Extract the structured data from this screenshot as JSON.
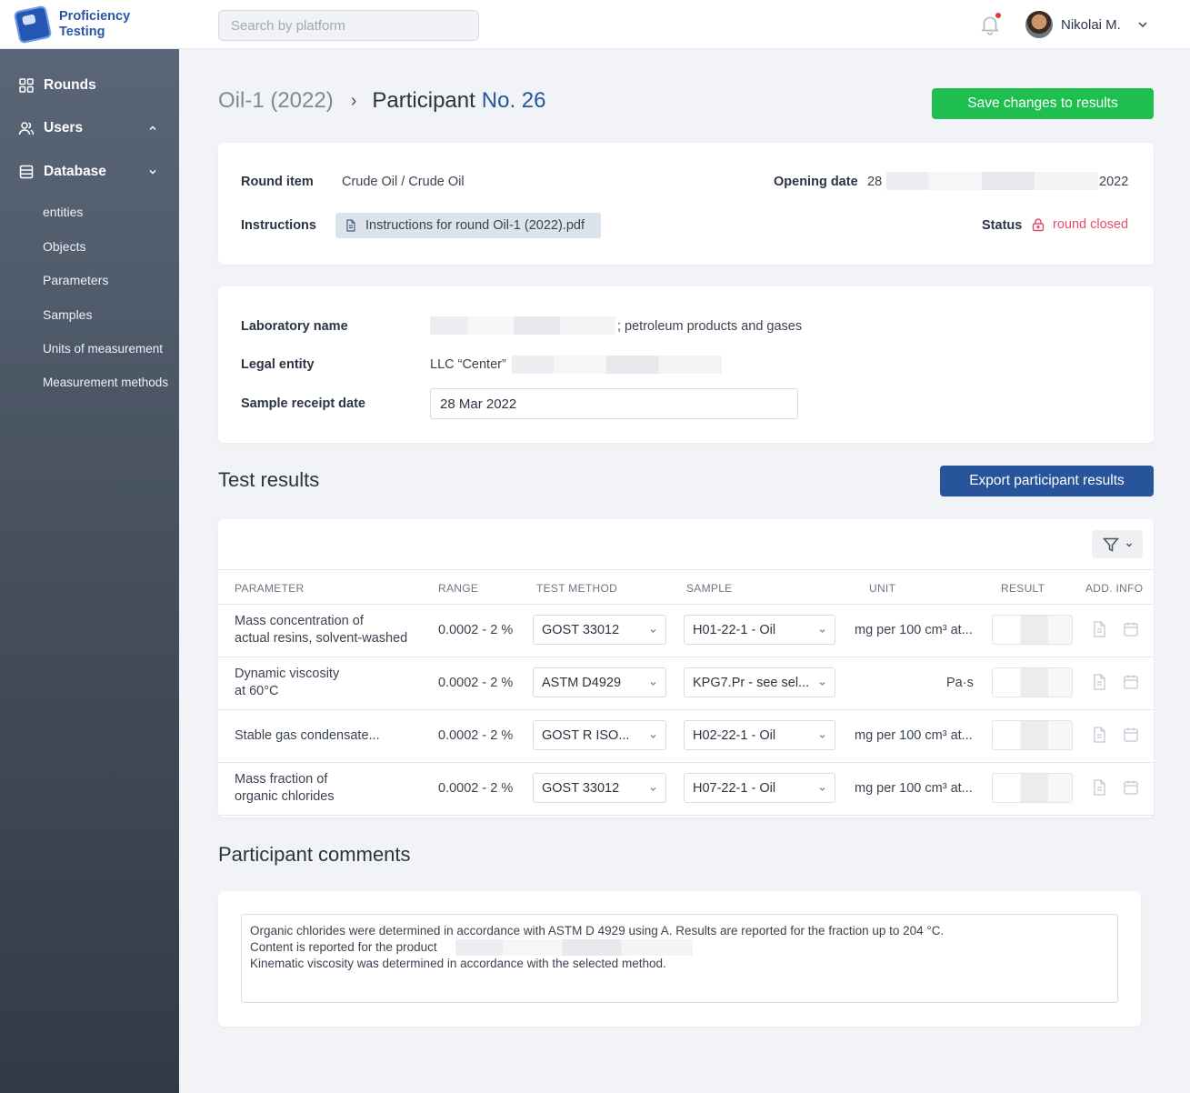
{
  "app": {
    "logo_text": "Proficiency Testing",
    "search_placeholder": "Search by platform",
    "user_name": "Nikolai M."
  },
  "sidebar": {
    "items": [
      {
        "label": "Rounds",
        "icon": "grid-icon"
      },
      {
        "label": "Users",
        "icon": "users-icon"
      },
      {
        "label": "Database",
        "icon": "database-icon"
      }
    ],
    "database_subitems": [
      "entities",
      "Objects",
      "Parameters",
      "Samples",
      "Units of measurement",
      "Measurement methods"
    ]
  },
  "breadcrumb": {
    "parent": "Oil-1 (2022)",
    "separator": "›",
    "current": "Participant",
    "number": "No. 26"
  },
  "actions": {
    "save_label": "Save changes to results",
    "export_label": "Export participant results"
  },
  "round_info": {
    "round_item_label": "Round item",
    "round_item_value": "Crude Oil / Crude Oil",
    "instructions_label": "Instructions",
    "instructions_file": "Instructions for round Oil-1 (2022).pdf",
    "opening_date_label": "Opening date",
    "opening_date_start": "28",
    "opening_date_end": "2022",
    "status_label": "Status",
    "status_value": "round closed"
  },
  "lab_info": {
    "lab_name_label": "Laboratory name",
    "lab_name_value": "; petroleum products and gases",
    "legal_entity_label": "Legal entity",
    "legal_entity_value": "LLC “Center”",
    "sample_receipt_label": "Sample receipt date",
    "sample_receipt_value": "28 Mar 2022"
  },
  "test_results": {
    "title": "Test results",
    "columns": [
      "PARAMETER",
      "RANGE",
      "TEST METHOD",
      "SAMPLE",
      "UNIT",
      "RESULT",
      "ADD. INFO"
    ],
    "rows": [
      {
        "parameter_1": "Mass concentration of",
        "parameter_2": "actual resins, solvent-washed",
        "range": "0.0002 - 2 %",
        "method": "GOST 33012",
        "sample": "H01-22-1 - Oil",
        "unit": "mg per 100 cm³ at..."
      },
      {
        "parameter_1": "Dynamic viscosity",
        "parameter_2": "at 60°C",
        "range": "0.0002 - 2 %",
        "method": "ASTM D4929",
        "sample": "KPG7.Pr - see sel...",
        "unit": "Pa·s"
      },
      {
        "parameter_1": "Stable gas condensate...",
        "parameter_2": "",
        "range": "0.0002 - 2 %",
        "method": "GOST R ISO...",
        "sample": "H02-22-1 - Oil",
        "unit": "mg per 100 cm³ at..."
      },
      {
        "parameter_1": "Mass fraction of",
        "parameter_2": "organic chlorides",
        "range": "0.0002 - 2 %",
        "method": "GOST 33012",
        "sample": "H07-22-1 - Oil",
        "unit": "mg per 100 cm³ at..."
      }
    ]
  },
  "comments": {
    "title": "Participant comments",
    "line_1": "Organic chlorides were determined in accordance with ASTM D 4929 using A. Results are reported for the fraction up to 204 °C.",
    "line_2": "Content is reported for the product",
    "line_3": "Kinematic viscosity was determined in accordance with the selected method."
  },
  "colors": {
    "accent_green": "#1fbf4f",
    "accent_blue": "#28549b",
    "status_closed": "#e64d6a",
    "link_blue": "#24579e"
  }
}
